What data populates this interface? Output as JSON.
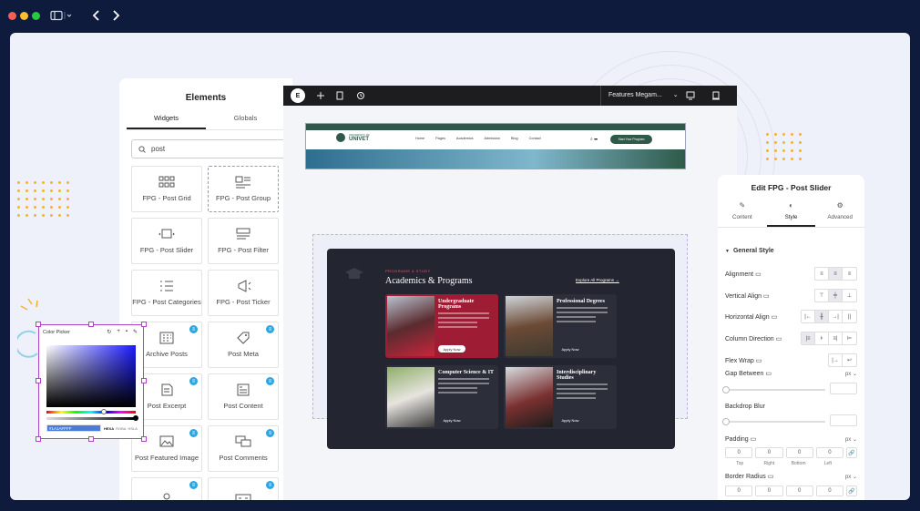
{
  "window": {
    "controls": [
      "close",
      "minimize",
      "maximize"
    ],
    "colors": {
      "close": "#f35f57",
      "minimize": "#f9bd2e",
      "maximize": "#28c840"
    }
  },
  "elements_panel": {
    "title": "Elements",
    "tabs": [
      "Widgets",
      "Globals"
    ],
    "search_value": "post",
    "widgets": [
      {
        "label": "FPG - Post Grid",
        "icon": "grid-icon",
        "badge": false,
        "selected": false
      },
      {
        "label": "FPG - Post Group",
        "icon": "group-icon",
        "badge": false,
        "selected": true
      },
      {
        "label": "FPG - Post Slider",
        "icon": "slider-icon",
        "badge": false,
        "selected": false
      },
      {
        "label": "FPG - Post Filter",
        "icon": "filter-icon",
        "badge": false,
        "selected": false
      },
      {
        "label": "FPG - Post Categories",
        "icon": "categories-icon",
        "badge": false,
        "selected": false
      },
      {
        "label": "FPG - Post Ticker",
        "icon": "ticker-icon",
        "badge": false,
        "selected": false
      },
      {
        "label": "Archive Posts",
        "icon": "archive-icon",
        "badge": true,
        "selected": false
      },
      {
        "label": "Post Meta",
        "icon": "tag-icon",
        "badge": true,
        "selected": false
      },
      {
        "label": "Post Excerpt",
        "icon": "excerpt-icon",
        "badge": true,
        "selected": false
      },
      {
        "label": "Post Content",
        "icon": "content-icon",
        "badge": true,
        "selected": false
      },
      {
        "label": "Post Featured Image",
        "icon": "image-icon",
        "badge": true,
        "selected": false
      },
      {
        "label": "Post Comments",
        "icon": "comments-icon",
        "badge": true,
        "selected": false
      },
      {
        "label": "",
        "icon": "author-icon",
        "badge": true,
        "selected": false
      },
      {
        "label": "",
        "icon": "navigation-icon",
        "badge": true,
        "selected": false
      }
    ]
  },
  "editor": {
    "page_selector": "Features Megam...",
    "site_header": {
      "logo_top": "UNIVERSITY OF",
      "logo": "UNIVET",
      "nav": [
        "Home",
        "Pages",
        "Academics",
        "Admission",
        "Blog",
        "Contact"
      ],
      "cta": "Start Your Program"
    },
    "slider": {
      "eyebrow": "PROGRAMS & STUDY",
      "heading": "Academics & Programs",
      "link": "Explore All Programs",
      "cards": [
        {
          "title": "Undergraduate Programs",
          "button": "Apply Now",
          "bg": "#9e1d35"
        },
        {
          "title": "Professional Degrees",
          "button": "Apply Now",
          "bg": "#2c2f3a"
        },
        {
          "title": "Computer Science & IT",
          "button": "Apply Now",
          "bg": "#2c2f3a"
        },
        {
          "title": "Interdisciplinary Studies",
          "button": "Apply Now",
          "bg": "#2c2f3a"
        }
      ]
    }
  },
  "edit_panel": {
    "title": "Edit FPG - Post Slider",
    "tabs": [
      "Content",
      "Style",
      "Advanced"
    ],
    "section": "General Style",
    "controls": {
      "alignment": "Alignment",
      "vertical_align": "Vertical Align",
      "horizontal_align": "Horizontal Align",
      "column_direction": "Column Direction",
      "flex_wrap": "Flex Wrap",
      "gap_between": "Gap Between",
      "backdrop_blur": "Backdrop Blur",
      "padding": "Padding",
      "border_radius": "Border Radius"
    },
    "unit": "px",
    "padding_values": [
      "0",
      "0",
      "0",
      "0"
    ],
    "border_radius_values": [
      "0",
      "0",
      "0",
      "0"
    ],
    "dim_labels": [
      "Top",
      "Right",
      "Bottom",
      "Left"
    ]
  },
  "color_picker": {
    "title": "Color Picker",
    "hex_value": "#1A1AFFFF",
    "formats": [
      "HEXA",
      "RGBA",
      "HSLA"
    ]
  }
}
